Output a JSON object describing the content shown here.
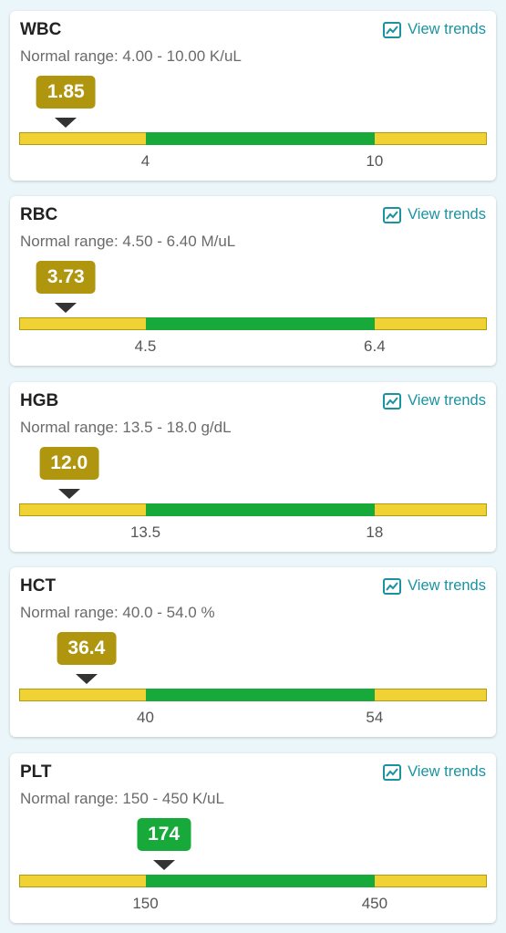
{
  "colors": {
    "low_badge": "#b0950f",
    "normal_badge": "#17a93a",
    "bar_abnormal": "#f0d234",
    "bar_normal": "#17a93a",
    "link": "#1a93a0"
  },
  "view_trends_label": "View trends",
  "view_trends_icon": "line-chart-icon",
  "tests": [
    {
      "name": "WBC",
      "range_text": "Normal range: 4.00 - 10.00 K/uL",
      "value_text": "1.85",
      "value": 1.85,
      "status": "low",
      "low_tick": "4",
      "high_tick": "10",
      "low": 4,
      "high": 10
    },
    {
      "name": "RBC",
      "range_text": "Normal range: 4.50 - 6.40 M/uL",
      "value_text": "3.73",
      "value": 3.73,
      "status": "low",
      "low_tick": "4.5",
      "high_tick": "6.4",
      "low": 4.5,
      "high": 6.4
    },
    {
      "name": "HGB",
      "range_text": "Normal range: 13.5 - 18.0 g/dL",
      "value_text": "12.0",
      "value": 12.0,
      "status": "low",
      "low_tick": "13.5",
      "high_tick": "18",
      "low": 13.5,
      "high": 18
    },
    {
      "name": "HCT",
      "range_text": "Normal range: 40.0 - 54.0 %",
      "value_text": "36.4",
      "value": 36.4,
      "status": "low",
      "low_tick": "40",
      "high_tick": "54",
      "low": 40,
      "high": 54
    },
    {
      "name": "PLT",
      "range_text": "Normal range: 150 - 450 K/uL",
      "value_text": "174",
      "value": 174,
      "status": "normal",
      "low_tick": "150",
      "high_tick": "450",
      "low": 150,
      "high": 450
    }
  ]
}
